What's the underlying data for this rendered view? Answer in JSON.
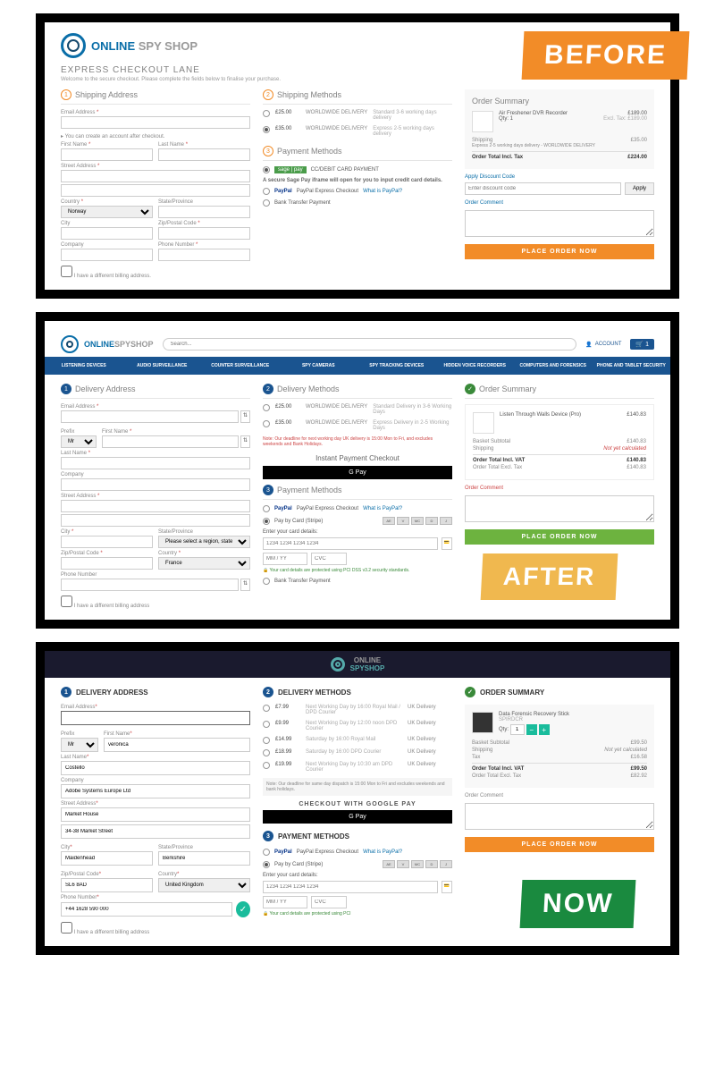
{
  "badges": {
    "before": "BEFORE",
    "after": "AFTER",
    "now": "NOW"
  },
  "brand": {
    "online": "ONLINE",
    "spy": "SPY",
    "shop": "SHOP",
    "spyshop": "SPYSHOP"
  },
  "c1": {
    "title": "EXPRESS CHECKOUT LANE",
    "subtitle": "Welcome to the secure checkout. Please complete the fields below to finalise your purchase.",
    "s1": "Shipping Address",
    "s2": "Shipping Methods",
    "s3": "Payment Methods",
    "email": "Email Address",
    "acct_note": "▸ You can create an account after checkout.",
    "fname": "First Name",
    "lname": "Last Name",
    "street": "Street Address",
    "country": "Country",
    "norway": "Norway",
    "state": "State/Province",
    "city": "City",
    "zip": "Zip/Postal Code",
    "company": "Company",
    "phone": "Phone Number",
    "diffbill": "I have a different billing address.",
    "ship1_p": "£25.00",
    "ship1_n": "WORLDWIDE DELIVERY",
    "ship1_d": "Standard 3-6 working days delivery",
    "ship2_p": "£35.00",
    "ship2_n": "WORLDWIDE DELIVERY",
    "ship2_d": "Express 2-5 working days delivery",
    "sage": "sage | pay",
    "ccdebit": "CC/DEBIT CARD PAYMENT",
    "sage_note": "A secure Sage Pay iframe will open for you to input credit card details.",
    "pp": "PayPal",
    "pp_exp": "PayPal Express Checkout",
    "pp_what": "What is PayPal?",
    "bank": "Bank Transfer Payment",
    "sum_h": "Order Summary",
    "item": "Air Freshener DVR Recorder",
    "item_p": "£189.00",
    "excl": "Excl. Tax: £189.00",
    "qty": "Qty: 1",
    "ship_lbl": "Shipping",
    "ship_desc": "Express 2-5 working days delivery - WORLDWIDE DELIVERY",
    "ship_cost": "£35.00",
    "total_lbl": "Order Total Incl. Tax",
    "total": "£224.00",
    "disc": "Apply Discount Code",
    "disc_ph": "Enter discount code",
    "apply": "Apply",
    "comment": "Order Comment",
    "place": "PLACE ORDER NOW"
  },
  "c2": {
    "search_ph": "Search...",
    "account": "ACCOUNT",
    "cart_n": "1",
    "nav": [
      "LISTENING DEVICES",
      "AUDIO SURVEILLANCE",
      "COUNTER SURVEILLANCE",
      "SPY CAMERAS",
      "SPY TRACKING DEVICES",
      "HIDDEN VOICE RECORDERS",
      "COMPUTERS AND FORENSICS",
      "PHONE AND TABLET SECURITY"
    ],
    "s1": "Delivery Address",
    "s2": "Delivery Methods",
    "s3": "Payment Methods",
    "sum_h": "Order Summary",
    "email": "Email Address",
    "prefix": "Prefix",
    "mr": "Mr",
    "fname": "First Name",
    "lname": "Last Name",
    "company": "Company",
    "street": "Street Address",
    "city": "City",
    "state": "State/Province",
    "state_ph": "Please select a region, state or",
    "zip": "Zip/Postal Code",
    "country": "Country",
    "france": "France",
    "phone": "Phone Number",
    "diffbill": "I have a different billing address",
    "ship1_p": "£25.00",
    "ship1_n": "WORLDWIDE DELIVERY",
    "ship1_d": "Standard Delivery in 3-6 Working Days",
    "ship2_p": "£35.00",
    "ship2_n": "WORLDWIDE DELIVERY",
    "ship2_d": "Express Delivery in 2-5 Working Days",
    "deadline": "Note: Our deadline for next working day UK delivery is 15:00 Mon to Fri, and excludes weekends and Bank Holidays.",
    "instant": "Instant Payment Checkout",
    "gpay": "G Pay",
    "pp_exp": "PayPal Express Checkout",
    "pp_what": "What is PayPal?",
    "paycard": "Pay by Card (Stripe)",
    "enter_card": "Enter your card details:",
    "card_ph": "1234 1234 1234 1234",
    "exp_ph": "MM / YY",
    "cvc_ph": "CVC",
    "pci": "Your card details are protected using PCI DSS v3.2 security standards.",
    "bank": "Bank Transfer Payment",
    "item": "Listen Through Walls Device (Pro)",
    "item_p": "£140.83",
    "sub_lbl": "Basket Subtotal",
    "sub_v": "£140.83",
    "ship_lbl": "Shipping",
    "ship_v": "Not yet calculated",
    "total_lbl": "Order Total Incl. VAT",
    "total_v": "£140.83",
    "excl_lbl": "Order Total Excl. Tax",
    "excl_v": "£140.83",
    "comment": "Order Comment",
    "place": "PLACE ORDER NOW"
  },
  "c3": {
    "s1": "DELIVERY ADDRESS",
    "s2": "DELIVERY METHODS",
    "s3": "PAYMENT METHODS",
    "sum_h": "ORDER SUMMARY",
    "email": "Email Address",
    "prefix": "Prefix",
    "mr": "Mr",
    "fname": "First Name",
    "fname_v": "veronica",
    "lname": "Last Name",
    "lname_v": "Costello",
    "company": "Company",
    "company_v": "Adobe Systems Europe Ltd",
    "street": "Street Address",
    "street1_v": "Market House",
    "street2_v": "34-38 Market Street",
    "city": "City",
    "city_v": "Maidenhead",
    "state": "State/Province",
    "state_v": "Berkshire",
    "zip": "Zip/Postal Code",
    "zip_v": "SL6 8AD",
    "country": "Country",
    "country_v": "United Kingdom",
    "phone": "Phone Number",
    "phone_v": "+44 1628 590 000",
    "diffbill": "I have a different billing address",
    "d1_p": "£7.99",
    "d1_n": "Next Working Day by 16:00 Royal Mail / DPD Courier",
    "d1_c": "UK Delivery",
    "d2_p": "£9.99",
    "d2_n": "Next Working Day by 12:00 noon DPD Courier",
    "d2_c": "UK Delivery",
    "d3_p": "£14.99",
    "d3_n": "Saturday by 16:00 Royal Mail",
    "d3_c": "UK Delivery",
    "d4_p": "£18.99",
    "d4_n": "Saturday by 16:00 DPD Courier",
    "d4_c": "UK Delivery",
    "d5_p": "£19.99",
    "d5_n": "Next Working Day by 10:30 am DPD Courier",
    "d5_c": "UK Delivery",
    "deadline": "Note: Our deadline for same day dispatch is 15:00 Mon to Fri and excludes weekends and bank holidays.",
    "gpay_h": "CHECKOUT WITH GOOGLE PAY",
    "gpay": "G Pay",
    "pp_exp": "PayPal Express Checkout",
    "pp_what": "What is PayPal?",
    "paycard": "Pay by Card (Stripe)",
    "enter_card": "Enter your card details:",
    "card_ph": "1234 1234 1234 1234",
    "exp_ph": "MM / YY",
    "cvc_ph": "CVC",
    "pci": "Your card details are protected using PCI",
    "item": "Data Forensic Recovery Stick",
    "item_sub": "SPIRDCR",
    "qty_v": "1",
    "sub_lbl": "Basket Subtotal",
    "sub_v": "£99.50",
    "ship_lbl": "Shipping",
    "ship_v": "Not yet calculated",
    "tax_lbl": "Tax",
    "tax_v": "£16.58",
    "total_lbl": "Order Total Incl. VAT",
    "total_v": "£99.50",
    "excl_lbl": "Order Total Excl. Tax",
    "excl_v": "£82.92",
    "comment": "Order Comment",
    "place": "PLACE ORDER NOW"
  }
}
